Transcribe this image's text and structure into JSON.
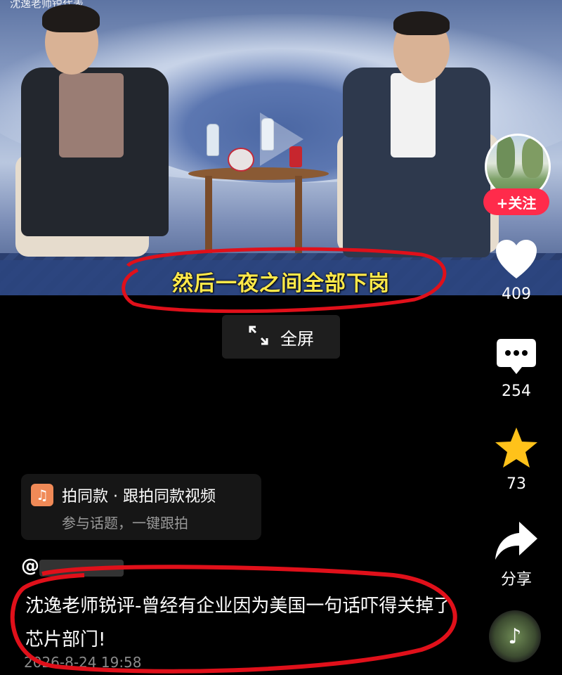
{
  "video": {
    "title_overlay": "沈逸老师锐代表",
    "subtitle": "然后一夜之间全部下岗"
  },
  "fullscreen_button": {
    "label": "全屏"
  },
  "author": {
    "follow_label": "+关注",
    "name": "@"
  },
  "actions": {
    "likes": "409",
    "comments": "254",
    "favorites": "73",
    "share_label": "分享"
  },
  "music_card": {
    "title": "拍同款 · 跟拍同款视频",
    "subtitle": "参与话题，一键跟拍"
  },
  "post": {
    "description": "沈逸老师锐评-曾经有企业因为美国一句话吓得关掉了芯片部门!",
    "timestamp": "2026-8-24 19:58"
  },
  "colors": {
    "subtitle": "#ffe94a",
    "follow_button": "#ff2b4b",
    "favorite_star": "#ffc21a",
    "annotation": "#e0101a"
  },
  "icons": [
    "expand-icon",
    "heart-icon",
    "comment-icon",
    "star-icon",
    "share-icon",
    "music-note-icon"
  ]
}
